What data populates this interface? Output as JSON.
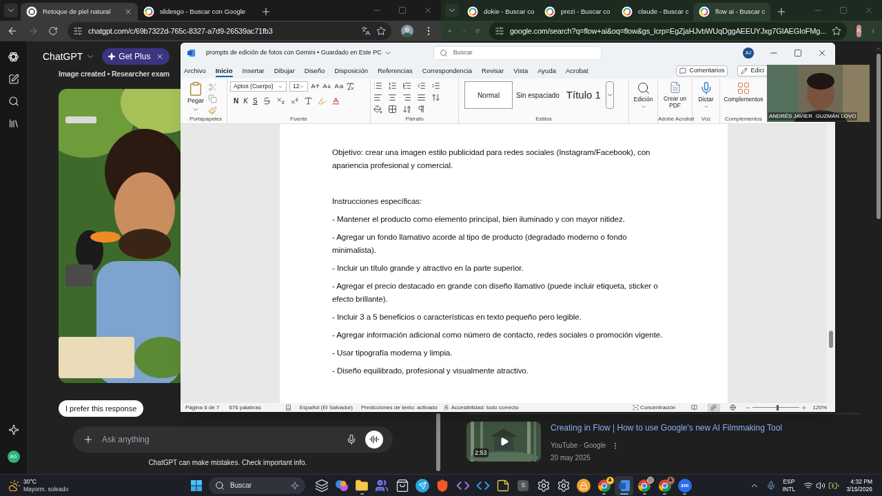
{
  "left_browser": {
    "tabs": [
      {
        "title": "Retoque de piel natural",
        "selected": true
      },
      {
        "title": "slidesgo - Buscar con Google",
        "selected": false
      }
    ],
    "url": "chatgpt.com/c/69b7322d-765c-8327-a7d9-26539ac71fb3",
    "chat": {
      "app_name": "ChatGPT",
      "upgrade": "Get Plus",
      "heading": "Image created • Researcher exam",
      "prefer_button": "I prefer this response",
      "input_placeholder": "Ask anything",
      "disclaimer": "ChatGPT can make mistakes. Check important info.",
      "user_avatar": "AG"
    }
  },
  "right_browser": {
    "tabs": [
      {
        "title": "dokie - Buscar co",
        "selected": false
      },
      {
        "title": "prezi - Buscar co",
        "selected": false
      },
      {
        "title": "claude - Buscar c",
        "selected": false
      },
      {
        "title": "flow ai - Buscar c",
        "selected": true
      }
    ],
    "url": "google.com/search?q=flow+ai&oq=flow&gs_lcrp=EgZjaHJvbWUqDggAEEUYJxg7GIAEGIoFMg...",
    "profile_avatar": "A",
    "video_result": {
      "duration": "2:53",
      "title": "Creating in Flow | How to use Google's new AI Filmmaking Tool",
      "source": "YouTube · Google",
      "date": "20 may 2025"
    }
  },
  "word": {
    "title": "prompts de edición de fotos con Gemini • Guardado en Este PC",
    "search_placeholder": "Buscar",
    "avatar": "AJ",
    "menu": [
      {
        "label": "Archivo",
        "selected": false
      },
      {
        "label": "Inicio",
        "selected": true
      },
      {
        "label": "Insertar",
        "selected": false
      },
      {
        "label": "Dibujar",
        "selected": false
      },
      {
        "label": "Diseño",
        "selected": false
      },
      {
        "label": "Disposición",
        "selected": false
      },
      {
        "label": "Referencias",
        "selected": false
      },
      {
        "label": "Correspondencia",
        "selected": false
      },
      {
        "label": "Revisar",
        "selected": false
      },
      {
        "label": "Vista",
        "selected": false
      },
      {
        "label": "Ayuda",
        "selected": false
      },
      {
        "label": "Acrobat",
        "selected": false
      }
    ],
    "comments_button": "Comentarios",
    "editing_button": "Edici",
    "ribbon": {
      "paste": "Pegar",
      "font": "Aptos (Cuerpo)",
      "size": "12",
      "bold": "N",
      "italic": "K",
      "underline": "S",
      "styles": [
        {
          "label": "Normal",
          "selected": true
        },
        {
          "label": "Sin espaciado",
          "selected": false
        },
        {
          "label": "Título 1",
          "selected": false
        }
      ],
      "editing": "Edición",
      "pdf": "Crear un PDF",
      "dictate": "Dictar",
      "addins": "Complementos",
      "groups": [
        "Portapapeles",
        "Fuente",
        "Párrafo",
        "Estilos",
        "Adobe Acrobat",
        "Voz",
        "Complementos"
      ]
    },
    "document": {
      "paragraphs": [
        {
          "kind": "text",
          "text": "Objetivo: crear una imagen estilo publicidad para redes sociales (Instagram/Facebook), con apariencia profesional y comercial."
        },
        {
          "kind": "empty"
        },
        {
          "kind": "text",
          "text": "Instrucciones específicas:"
        },
        {
          "kind": "text",
          "text": "- Mantener el producto como elemento principal, bien iluminado y con mayor nitidez."
        },
        {
          "kind": "text",
          "text": "- Agregar un fondo llamativo acorde al tipo de producto (degradado moderno o fondo minimalista)."
        },
        {
          "kind": "text",
          "text": "- Incluir un título grande y atractivo en la parte superior."
        },
        {
          "kind": "text",
          "text": "- Agregar el precio destacado en grande con diseño llamativo (puede incluir etiqueta, sticker o efecto brillante)."
        },
        {
          "kind": "text",
          "text": "- Incluir 3 a 5 beneficios o características en texto pequeño pero legible."
        },
        {
          "kind": "text",
          "text": "- Agregar información adicional como número de contacto, redes sociales o promoción vigente."
        },
        {
          "kind": "text",
          "text": "- Usar tipografía moderna y limpia."
        },
        {
          "kind": "text",
          "text": "- Diseño equilibrado, profesional y visualmente atractivo."
        }
      ]
    },
    "status": {
      "page": "Página 6 de 7",
      "words": "676 palabras",
      "language": "Español (El Salvador)",
      "predictions": "Predicciones de texto: activado",
      "accessibility": "Accesibilidad: todo correcto",
      "focus": "Concentración",
      "views": [
        {
          "kind": "read",
          "selected": false
        },
        {
          "kind": "print",
          "selected": true
        },
        {
          "kind": "web",
          "selected": false
        }
      ],
      "zoom": {
        "level": 0.55,
        "reading": "120%"
      }
    }
  },
  "webcam": {
    "name": "ANDRÉS JAVIER  GUZMÁN LOVO"
  },
  "taskbar": {
    "temperature": "30°C",
    "weather": "Mayorm. soleado",
    "search_placeholder": "Buscar",
    "apps": [
      {
        "kind": "task-view",
        "open": false,
        "selected": false
      },
      {
        "kind": "copilot",
        "open": false,
        "selected": false
      },
      {
        "kind": "explorer",
        "open": true,
        "selected": false
      },
      {
        "kind": "teams",
        "open": false,
        "selected": false
      },
      {
        "kind": "store",
        "open": false,
        "selected": false
      },
      {
        "kind": "telegram",
        "open": false,
        "selected": false
      },
      {
        "kind": "brave",
        "open": false,
        "selected": false
      },
      {
        "kind": "visual-studio",
        "open": false,
        "selected": false
      },
      {
        "kind": "vscode",
        "open": false,
        "selected": false
      },
      {
        "kind": "notes",
        "open": false,
        "selected": false
      },
      {
        "kind": "letter",
        "glyph": "S",
        "open": false,
        "selected": false
      },
      {
        "kind": "gear",
        "open": false,
        "selected": false
      },
      {
        "kind": "gear",
        "open": false,
        "selected": false
      },
      {
        "kind": "vault",
        "open": false,
        "selected": false
      },
      {
        "kind": "chrome",
        "badge": "A",
        "color": "#f4c430",
        "open": true,
        "selected": false
      },
      {
        "kind": "word",
        "open": true,
        "selected": true
      },
      {
        "kind": "chrome",
        "photo_badge": true,
        "open": true,
        "selected": false
      },
      {
        "kind": "chrome",
        "badge": "A",
        "color": "#a0705a",
        "open": true,
        "selected": false
      },
      {
        "kind": "zoom",
        "glyph": "zm",
        "open": true,
        "selected": false
      }
    ],
    "language": "ESP",
    "layout": "INTL",
    "time": "4:32 PM",
    "date": "3/15/2026"
  }
}
